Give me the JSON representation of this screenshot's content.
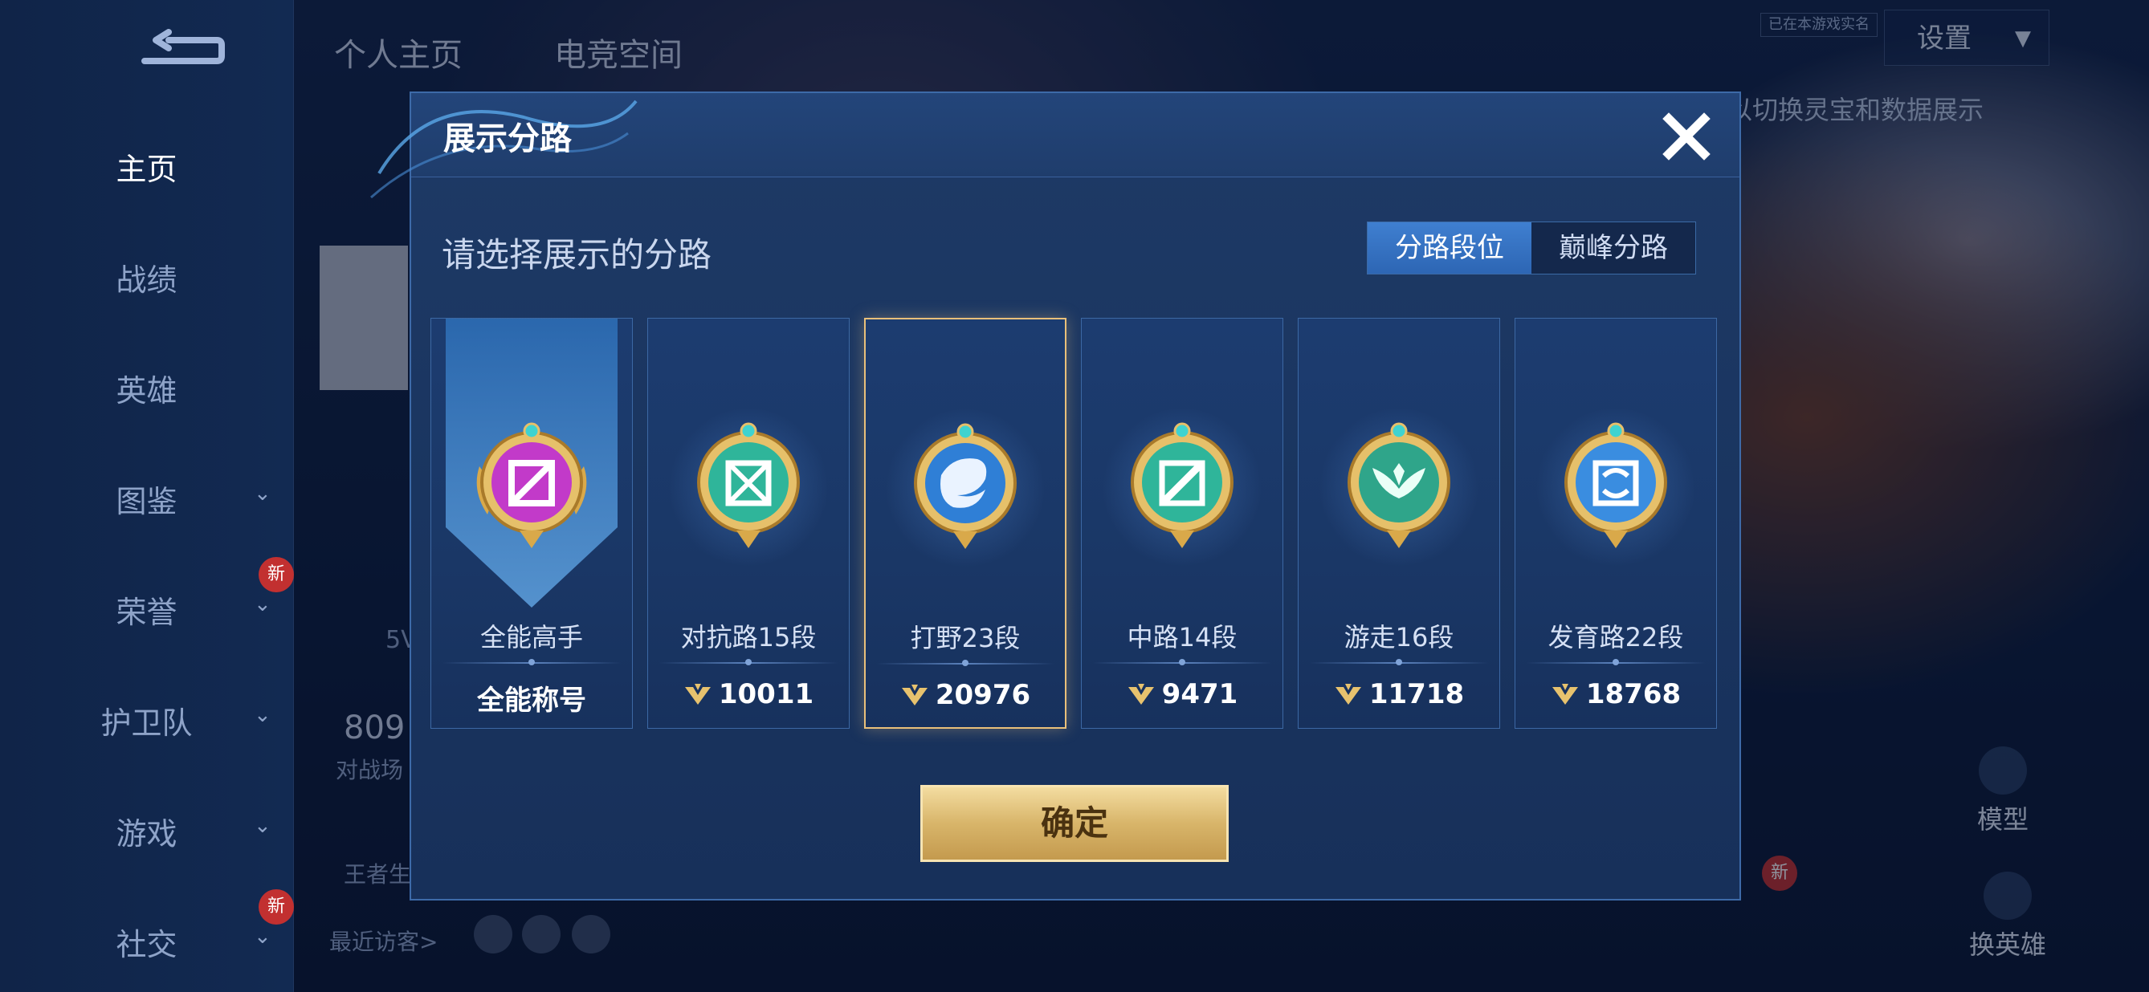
{
  "left_nav": {
    "items": [
      {
        "label": "主页",
        "active": true
      },
      {
        "label": "战绩"
      },
      {
        "label": "英雄"
      },
      {
        "label": "图鉴"
      },
      {
        "label": "荣誉"
      },
      {
        "label": "护卫队"
      },
      {
        "label": "游戏"
      },
      {
        "label": "社交"
      }
    ],
    "new_badge": "新"
  },
  "top_tabs": [
    "个人主页",
    "电竞空间"
  ],
  "settings": {
    "label": "设置",
    "tip": "已在本游戏实名"
  },
  "bg_hint": "以切换灵宝和数据展示",
  "profile": {
    "num_fragment": "809",
    "battles_label": "对战场",
    "level_fragment": "5V",
    "king_fragment": "王者生",
    "recent_visitors": "最近访客>"
  },
  "side_buttons": {
    "model": "模型",
    "change_hero": "换英雄",
    "new_badge": "新"
  },
  "dialog": {
    "title": "展示分路",
    "subtitle": "请选择展示的分路",
    "segment": {
      "options": [
        "分路段位",
        "巅峰分路"
      ],
      "selected_index": 0
    },
    "cards": [
      {
        "label": "全能高手",
        "score": "全能称号",
        "icon": "all-round-emblem",
        "color": "#c23ac9"
      },
      {
        "label": "对抗路15段",
        "score": "10011",
        "icon": "clash-lane-emblem",
        "color": "#2fb59a"
      },
      {
        "label": "打野23段",
        "score": "20976",
        "icon": "jungle-dragon-emblem",
        "color": "#2f7fd6",
        "selected": true
      },
      {
        "label": "中路14段",
        "score": "9471",
        "icon": "mid-lane-emblem",
        "color": "#2fb59a"
      },
      {
        "label": "游走16段",
        "score": "11718",
        "icon": "roam-emblem",
        "color": "#2fa58a"
      },
      {
        "label": "发育路22段",
        "score": "18768",
        "icon": "farm-lane-emblem",
        "color": "#3a8de0"
      }
    ],
    "confirm_label": "确定"
  }
}
